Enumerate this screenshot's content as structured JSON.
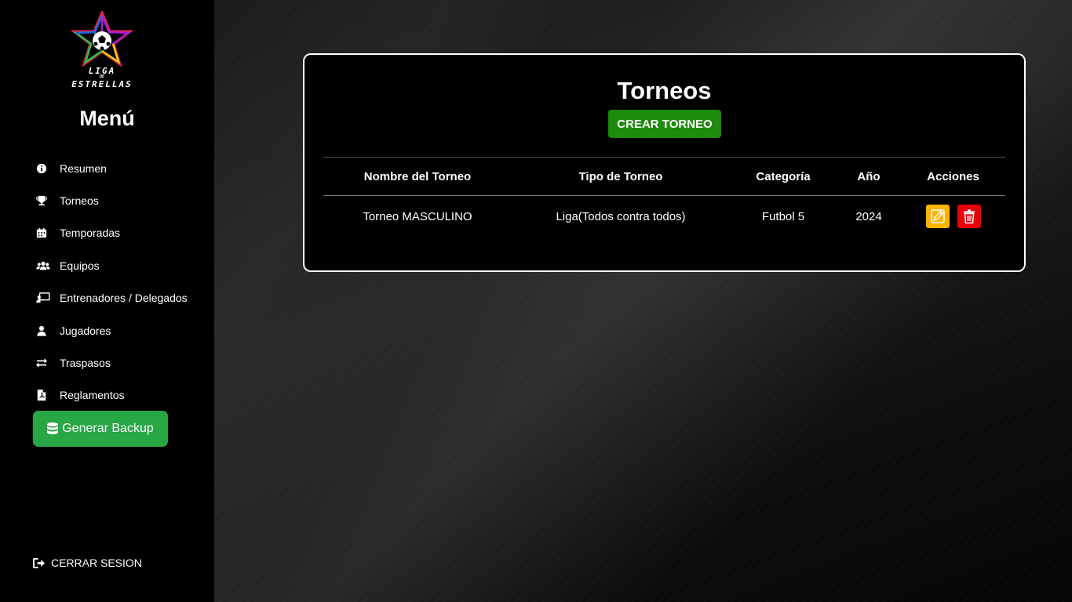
{
  "logo": {
    "line1": "LIGA",
    "line2": "DE",
    "line3": "ESTRELLAS"
  },
  "sidebar": {
    "title": "Menú",
    "items": [
      {
        "label": "Resumen",
        "icon": "info-icon"
      },
      {
        "label": "Torneos",
        "icon": "trophy-icon"
      },
      {
        "label": "Temporadas",
        "icon": "calendar-icon"
      },
      {
        "label": "Equipos",
        "icon": "users-icon"
      },
      {
        "label": "Entrenadores / Delegados",
        "icon": "chalkboard-teacher-icon"
      },
      {
        "label": "Jugadores",
        "icon": "user-icon"
      },
      {
        "label": "Traspasos",
        "icon": "exchange-icon"
      },
      {
        "label": "Reglamentos",
        "icon": "file-pdf-icon"
      }
    ],
    "backup_label": "Generar Backup",
    "logout_label": "CERRAR SESION"
  },
  "main": {
    "title": "Torneos",
    "create_label": "CREAR TORNEO",
    "columns": [
      "Nombre del Torneo",
      "Tipo de Torneo",
      "Categoría",
      "Año",
      "Acciones"
    ],
    "rows": [
      {
        "nombre": "Torneo MASCULINO",
        "tipo": "Liga(Todos contra todos)",
        "categoria": "Futbol 5",
        "anio": "2024"
      }
    ]
  },
  "colors": {
    "create_button": "#1e8a0e",
    "backup_button": "#28a745",
    "edit_button": "#ffb400",
    "delete_button": "#e8000b"
  }
}
